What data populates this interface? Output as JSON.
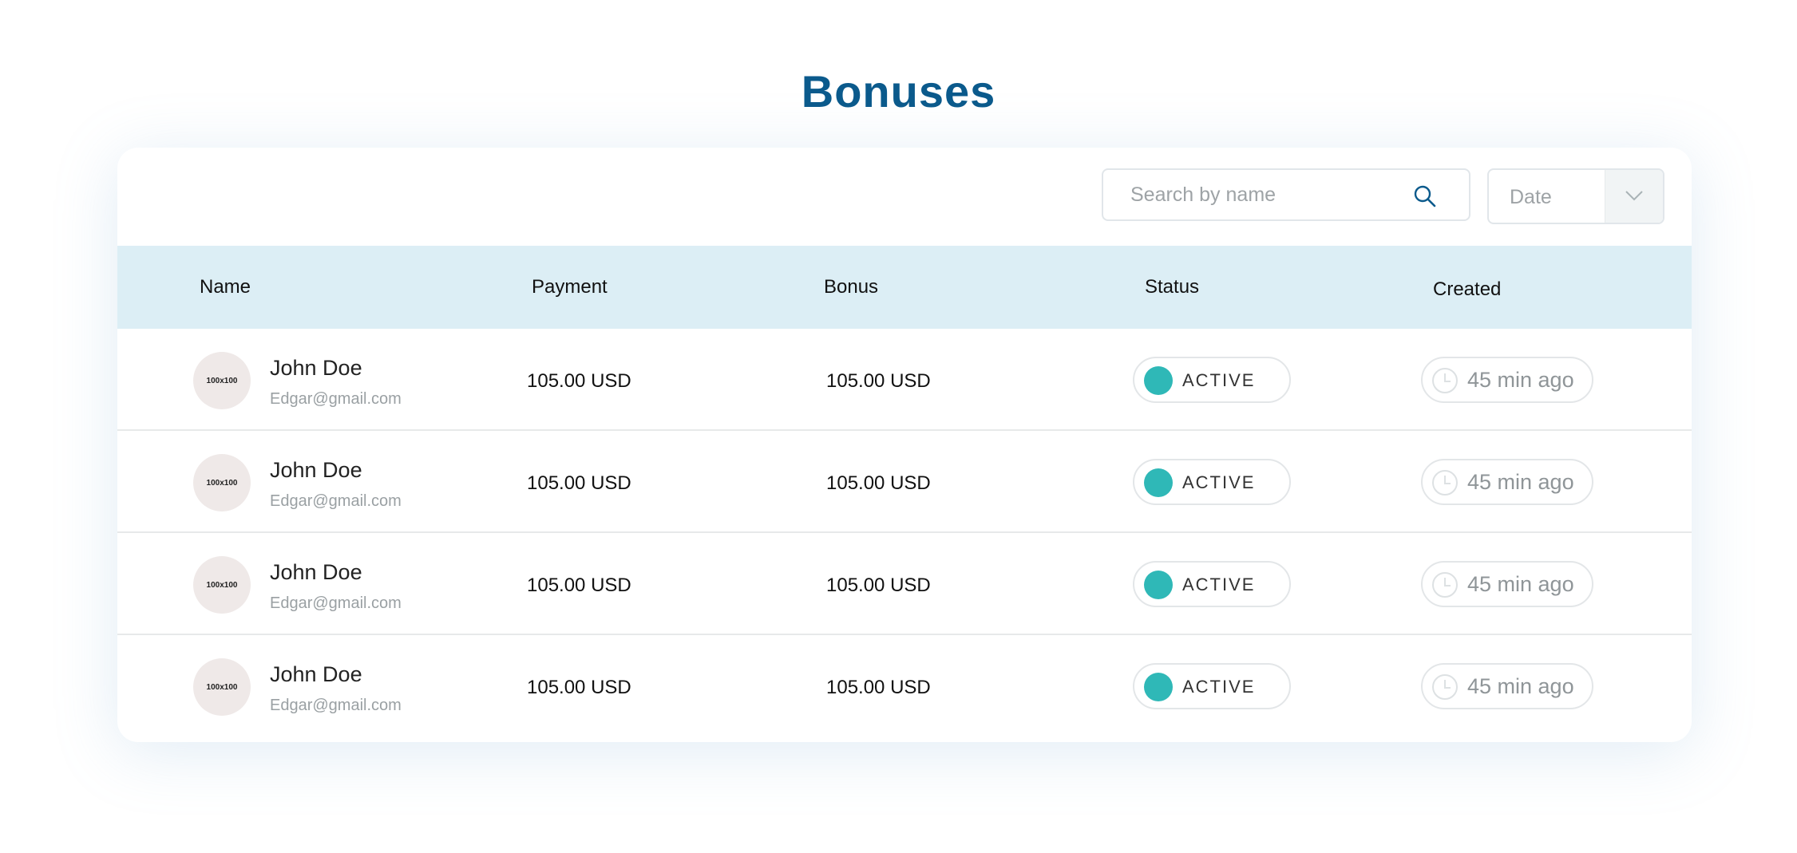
{
  "page": {
    "title": "Bonuses"
  },
  "toolbar": {
    "search_placeholder": "Search by name",
    "search_value": "",
    "date_filter_label": "Date"
  },
  "table": {
    "columns": [
      "Name",
      "Payment",
      "Bonus",
      "Status",
      "Created"
    ],
    "rows": [
      {
        "avatar_text": "100x100",
        "name": "John Doe",
        "email": "Edgar@gmail.com",
        "payment": "105.00 USD",
        "bonus": "105.00 USD",
        "status": "ACTIVE",
        "created": "45 min ago"
      },
      {
        "avatar_text": "100x100",
        "name": "John Doe",
        "email": "Edgar@gmail.com",
        "payment": "105.00 USD",
        "bonus": "105.00 USD",
        "status": "ACTIVE",
        "created": "45 min ago"
      },
      {
        "avatar_text": "100x100",
        "name": "John Doe",
        "email": "Edgar@gmail.com",
        "payment": "105.00 USD",
        "bonus": "105.00 USD",
        "status": "ACTIVE",
        "created": "45 min ago"
      },
      {
        "avatar_text": "100x100",
        "name": "John Doe",
        "email": "Edgar@gmail.com",
        "payment": "105.00 USD",
        "bonus": "105.00 USD",
        "status": "ACTIVE",
        "created": "45 min ago"
      }
    ]
  },
  "icons": {
    "search": "search-icon",
    "dropdown": "chevron-down-icon",
    "time": "clock-icon"
  },
  "colors": {
    "title": "#0b5a8c",
    "header_bg": "#dceef5",
    "status_active": "#2fb8b7"
  }
}
